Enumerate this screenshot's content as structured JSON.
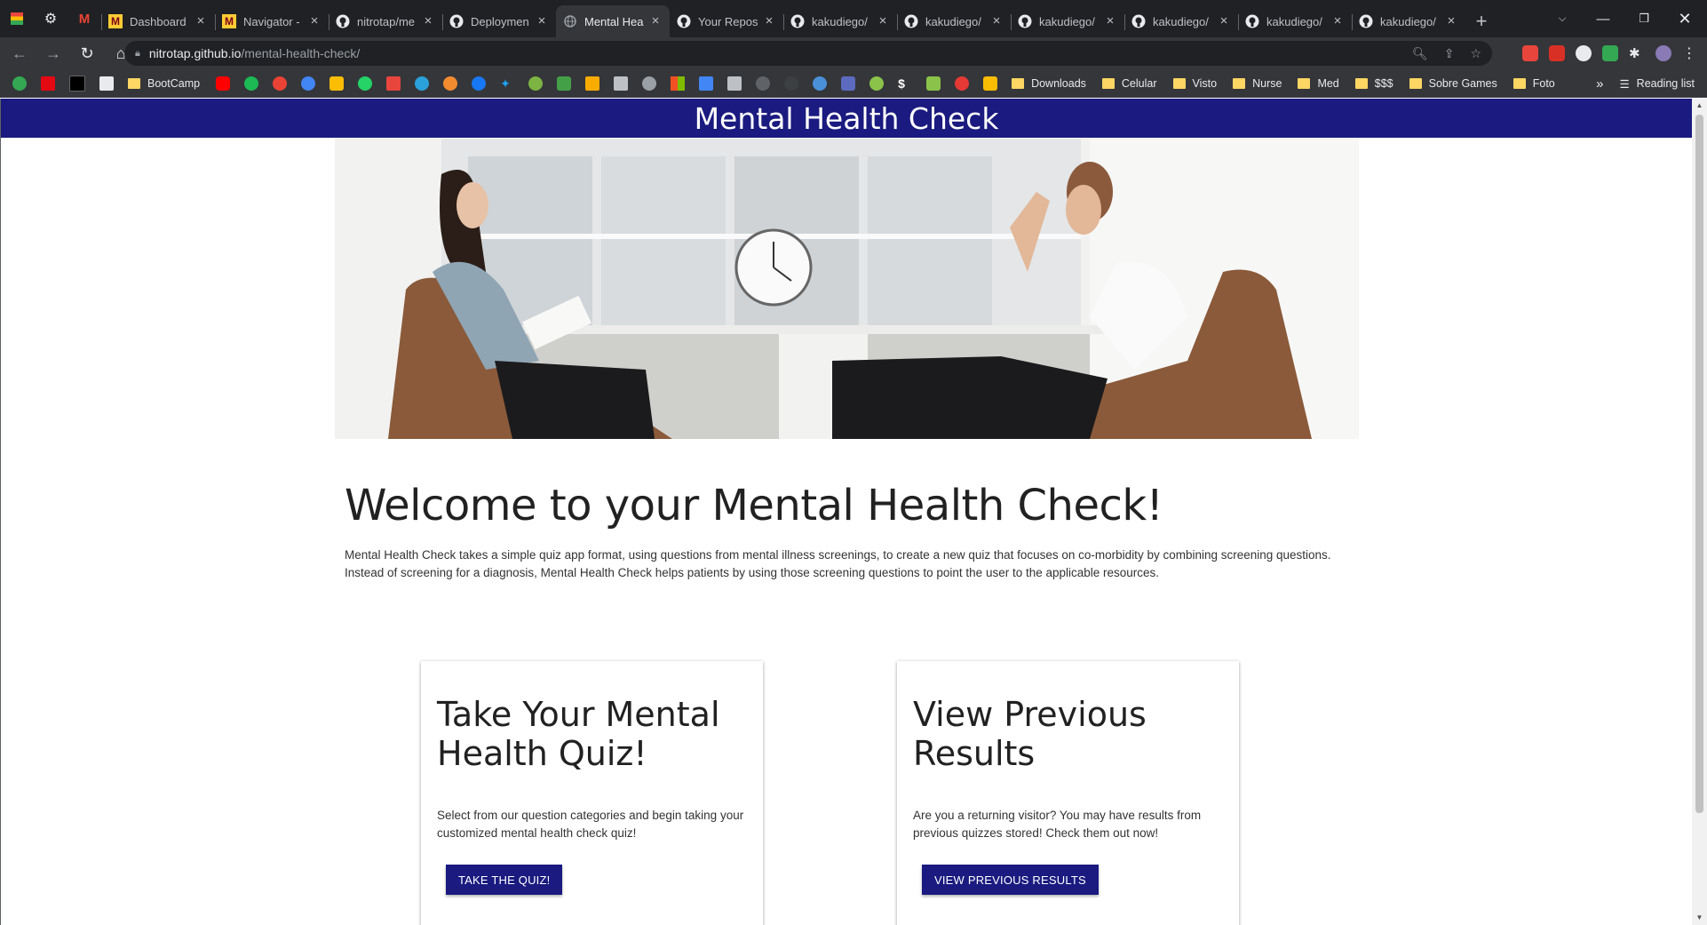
{
  "browser": {
    "tabs": [
      {
        "title": "Dashboard",
        "active": false
      },
      {
        "title": "Navigator -",
        "active": false
      },
      {
        "title": "nitrotap/me",
        "active": false
      },
      {
        "title": "Deploymen",
        "active": false
      },
      {
        "title": "Mental Hea",
        "active": true
      },
      {
        "title": "Your Repos",
        "active": false
      },
      {
        "title": "kakudiego/",
        "active": false
      },
      {
        "title": "kakudiego/",
        "active": false
      },
      {
        "title": "kakudiego/",
        "active": false
      },
      {
        "title": "kakudiego/",
        "active": false
      },
      {
        "title": "kakudiego/",
        "active": false
      },
      {
        "title": "kakudiego/",
        "active": false
      }
    ],
    "url_domain": "nitrotap.github.io",
    "url_path": "/mental-health-check/",
    "bookmarks": [
      "BootCamp",
      "Downloads",
      "Celular",
      "Visto",
      "Nurse",
      "Med",
      "$$$",
      "Sobre Games",
      "Foto"
    ],
    "reading_list": "Reading list",
    "overflow": "»"
  },
  "page": {
    "header_title": "Mental Health Check",
    "welcome_heading": "Welcome to your Mental Health Check!",
    "intro_text": "Mental Health Check takes a simple quiz app format, using questions from mental illness screenings, to create a new quiz that focuses on co-morbidity by combining screening questions. Instead of screening for a diagnosis, Mental Health Check helps patients by using those screening questions to point the user to the applicable resources.",
    "cards": [
      {
        "title": "Take Your Mental Health Quiz!",
        "text": "Select from our question categories and begin taking your customized mental health check quiz!",
        "button": "TAKE THE QUIZ!"
      },
      {
        "title": "View Previous Results",
        "text": "Are you a returning visitor? You may have results from previous quizzes stored! Check them out now!",
        "button": "VIEW PREVIOUS RESULTS"
      }
    ]
  },
  "colors": {
    "brand_navy": "#1a1a80",
    "chrome_dark": "#202124",
    "chrome_toolbar": "#35363a"
  }
}
